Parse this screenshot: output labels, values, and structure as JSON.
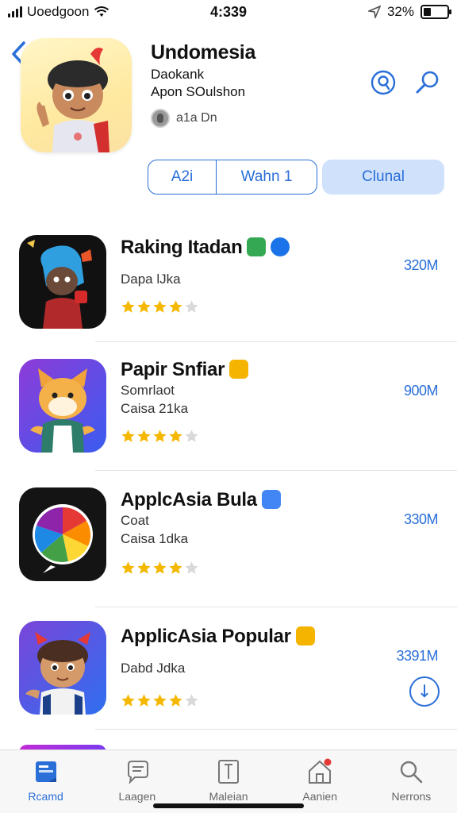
{
  "status_bar": {
    "carrier": "Uoedgoon",
    "time": "4:339",
    "battery_text": "32%",
    "battery_level": 0.32,
    "icons": [
      "signal-icon",
      "wifi-icon",
      "location-arrow-icon",
      "battery-icon"
    ]
  },
  "header": {
    "title": "Undomesia",
    "subtitle_1": "Daokank",
    "subtitle_2": "Apon SOulshon",
    "developer": "a1a Dn",
    "icons": [
      "back-chevron-icon",
      "app-mascot-icon",
      "developer-avatar-icon",
      "shield-search-icon",
      "search-icon"
    ]
  },
  "segmented": {
    "option_1": "A2i",
    "option_2": "Wahn 1",
    "action": "Clunal"
  },
  "apps": [
    {
      "title": "Raking Itadan",
      "line_1": "Dapa lJka",
      "line_2": "",
      "size": "320M",
      "rating": 4,
      "badges": [
        "#34a853",
        "#1a73e8"
      ]
    },
    {
      "title": "Papir Snfiar",
      "line_1": "Somrlaot",
      "line_2": "Caisa 21ka",
      "size": "900M",
      "rating": 4,
      "badges": [
        "#f4b400"
      ]
    },
    {
      "title": "ApplcAsia Bula",
      "line_1": "Coat",
      "line_2": "Caisa 1dka",
      "size": "330M",
      "rating": 4,
      "badges": [
        "#4285f4"
      ]
    },
    {
      "title": "ApplicAsia Popular",
      "line_1": "Dabd Jdka",
      "line_2": "",
      "size": "3391M",
      "rating": 4,
      "badges": [
        "#f4b400"
      ]
    }
  ],
  "tabs": [
    {
      "label": "Rcamd",
      "icon": "today-icon",
      "active": true
    },
    {
      "label": "Laagen",
      "icon": "chat-stack-icon",
      "active": false
    },
    {
      "label": "Maleian",
      "icon": "book-icon",
      "active": false
    },
    {
      "label": "Aanien",
      "icon": "home-icon",
      "active": false
    },
    {
      "label": "Nerrons",
      "icon": "search-icon",
      "active": false
    }
  ],
  "colors": {
    "accent": "#2a6fd8",
    "star": "#f5b800",
    "star_empty": "#d9d9d9",
    "notification": "#e53935"
  }
}
